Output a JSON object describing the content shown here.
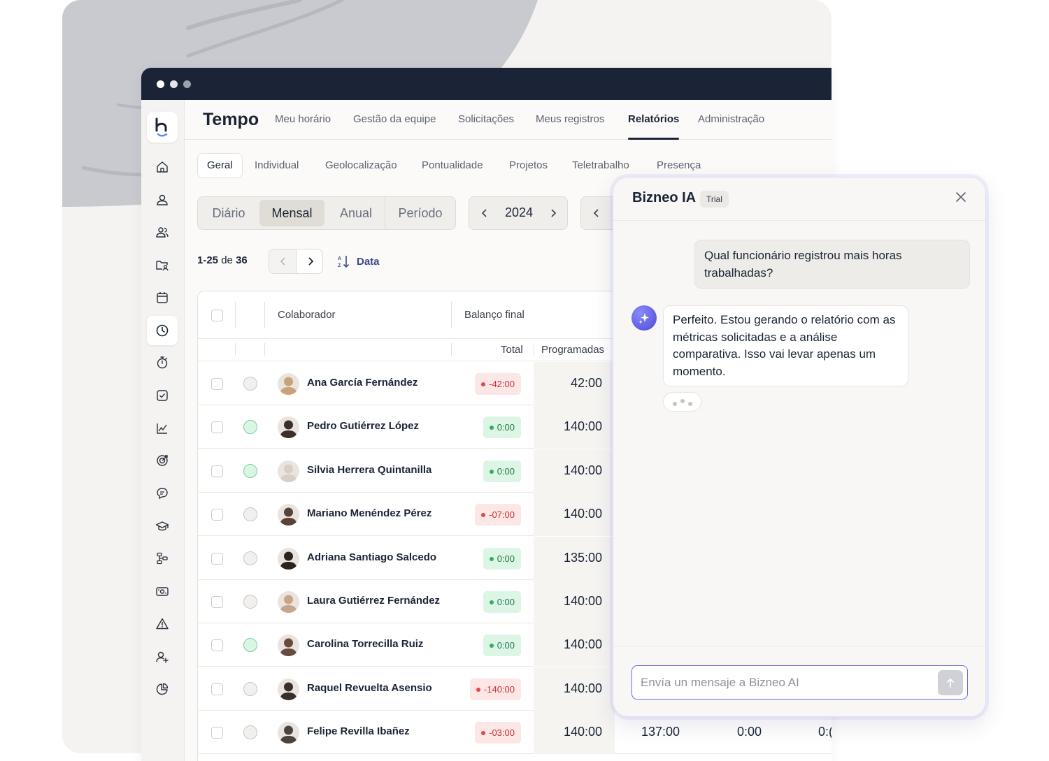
{
  "window": {
    "controls": [
      "close",
      "minimize",
      "maximize"
    ]
  },
  "app": {
    "title": "Tempo",
    "top_nav": [
      {
        "label": "Meu horário",
        "active": false
      },
      {
        "label": "Gestão da equipe",
        "active": false
      },
      {
        "label": "Solicitações",
        "active": false
      },
      {
        "label": "Meus registros",
        "active": false
      },
      {
        "label": "Relatórios",
        "active": true
      },
      {
        "label": "Administração",
        "active": false
      }
    ],
    "sub_nav": [
      {
        "label": "Geral",
        "active": true
      },
      {
        "label": "Individual",
        "active": false
      },
      {
        "label": "Geolocalização",
        "active": false
      },
      {
        "label": "Pontualidade",
        "active": false
      },
      {
        "label": "Projetos",
        "active": false
      },
      {
        "label": "Teletrabalho",
        "active": false
      },
      {
        "label": "Presença",
        "active": false
      }
    ],
    "period_tabs": [
      {
        "label": "Diário",
        "active": false
      },
      {
        "label": "Mensal",
        "active": true
      },
      {
        "label": "Anual",
        "active": false
      },
      {
        "label": "Período",
        "active": false
      }
    ],
    "year": "2024",
    "pagination": {
      "range": "1-25",
      "of": "de",
      "total": "36"
    },
    "sort_label": "Data"
  },
  "sidebar": {
    "logo": "b",
    "items": [
      {
        "icon": "home-icon",
        "active": false
      },
      {
        "icon": "user-icon",
        "active": false
      },
      {
        "icon": "users-icon",
        "active": false
      },
      {
        "icon": "folder-user-icon",
        "active": false
      },
      {
        "icon": "calendar-icon",
        "active": false
      },
      {
        "icon": "clock-icon",
        "active": true
      },
      {
        "icon": "stopwatch-icon",
        "active": false
      },
      {
        "icon": "checkbox-icon",
        "active": false
      },
      {
        "icon": "line-chart-icon",
        "active": false
      },
      {
        "icon": "target-icon",
        "active": false
      },
      {
        "icon": "chat-icon",
        "active": false
      },
      {
        "icon": "graduation-cap-icon",
        "active": false
      },
      {
        "icon": "workflow-icon",
        "active": false
      },
      {
        "icon": "money-icon",
        "active": false
      },
      {
        "icon": "warning-icon",
        "active": false
      },
      {
        "icon": "user-add-icon",
        "active": false
      },
      {
        "icon": "pie-chart-icon",
        "active": false
      }
    ]
  },
  "table": {
    "headers": {
      "collaborator": "Colaborador",
      "final_balance": "Balanço final",
      "total": "Total",
      "scheduled": "Programadas"
    },
    "rows": [
      {
        "name": "Ana García Fernández",
        "status_on": false,
        "balance": "-42:00",
        "negative": true,
        "scheduled": "42:00",
        "avatar_color": "#c9a27a"
      },
      {
        "name": "Pedro Gutiérrez López",
        "status_on": true,
        "balance": "0:00",
        "negative": false,
        "scheduled": "140:00",
        "avatar_color": "#3b2f2a"
      },
      {
        "name": "Silvia Herrera Quintanilla",
        "status_on": true,
        "balance": "0:00",
        "negative": false,
        "scheduled": "140:00",
        "avatar_color": "#d9cfc4"
      },
      {
        "name": "Mariano Menéndez Pérez",
        "status_on": false,
        "balance": "-07:00",
        "negative": true,
        "scheduled": "140:00",
        "avatar_color": "#5a4336"
      },
      {
        "name": "Adriana Santiago Salcedo",
        "status_on": false,
        "balance": "0:00",
        "negative": false,
        "scheduled": "135:00",
        "avatar_color": "#2a221f"
      },
      {
        "name": "Laura Gutiérrez Fernández",
        "status_on": false,
        "balance": "0:00",
        "negative": false,
        "scheduled": "140:00",
        "avatar_color": "#c8a58a"
      },
      {
        "name": "Carolina Torrecilla Ruiz",
        "status_on": true,
        "balance": "0:00",
        "negative": false,
        "scheduled": "140:00",
        "avatar_color": "#6b4a3e"
      },
      {
        "name": "Raquel Revuelta Asensio",
        "status_on": false,
        "balance": "-140:00",
        "negative": true,
        "scheduled": "140:00",
        "avatar_color": "#3a2e2a"
      },
      {
        "name": "Felipe Revilla Ibañez",
        "status_on": false,
        "balance": "-03:00",
        "negative": true,
        "scheduled": "140:00",
        "avatar_color": "#4a4440",
        "extra": [
          "137:00",
          "0:00",
          "0:("
        ]
      }
    ]
  },
  "chat": {
    "title": "Bizneo IA",
    "badge": "Trial",
    "user_message": "Qual funcionário registrou mais horas trabalhadas?",
    "ai_message": "Perfeito. Estou gerando o relatório com as métricas solicitadas e a análise comparativa. Isso vai levar apenas um momento.",
    "input_placeholder": "Envía un mensaje a Bizneo AI"
  },
  "colors": {
    "titlebar": "#1b2436",
    "accent": "#6a6fd6",
    "negative": "#c73535",
    "positive": "#1f7a44"
  }
}
